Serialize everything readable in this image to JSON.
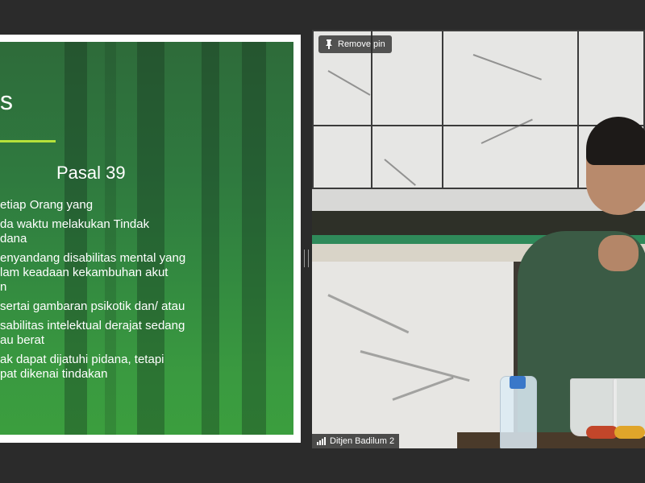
{
  "slide": {
    "title": "s",
    "subtitle": "Pasal 39",
    "bullets": [
      "etiap Orang yang",
      "da waktu melakukan Tindak\ndana",
      "enyandang disabilitas mental yang\nlam keadaan kekambuhan akut\nn",
      "sertai gambaran psikotik dan/ atau",
      "sabilitas intelektual derajat sedang\nau berat",
      "ak dapat dijatuhi pidana, tetapi\npat dikenai tindakan"
    ]
  },
  "video": {
    "pin_label": "Remove pin",
    "participant_name": "Ditjen Badilum 2"
  },
  "icons": {
    "pin": "pin-icon",
    "signal": "signal-bars-icon"
  },
  "colors": {
    "slide_green": "#338a40",
    "title_accent": "#b6e23a",
    "background": "#2b2b2b"
  }
}
